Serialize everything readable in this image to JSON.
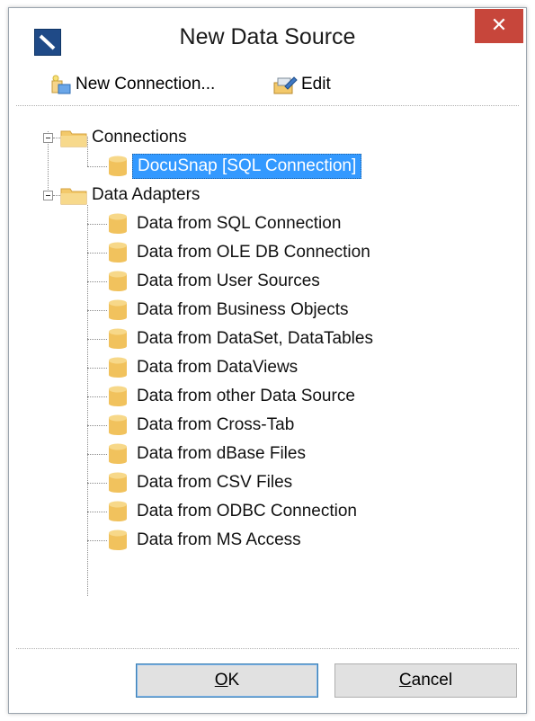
{
  "window": {
    "title": "New Data Source",
    "close_symbol": "✕"
  },
  "toolbar": {
    "new_connection_label": "New Connection...",
    "edit_label": "Edit",
    "new_connection_icon": "new-connection-icon",
    "edit_icon": "edit-icon"
  },
  "tree": {
    "connections": {
      "label": "Connections",
      "items": [
        {
          "label": "DocuSnap [SQL Connection]",
          "selected": true
        }
      ]
    },
    "data_adapters": {
      "label": "Data Adapters",
      "items": [
        {
          "label": "Data from SQL Connection"
        },
        {
          "label": "Data from OLE DB Connection"
        },
        {
          "label": "Data from User Sources"
        },
        {
          "label": "Data from Business Objects"
        },
        {
          "label": "Data from DataSet, DataTables"
        },
        {
          "label": "Data from DataViews"
        },
        {
          "label": "Data from other Data Source"
        },
        {
          "label": "Data from Cross-Tab"
        },
        {
          "label": "Data from dBase Files"
        },
        {
          "label": "Data from CSV Files"
        },
        {
          "label": "Data from ODBC Connection"
        },
        {
          "label": "Data from MS Access"
        }
      ]
    }
  },
  "buttons": {
    "ok_accel": "O",
    "ok_rest": "K",
    "cancel_accel": "C",
    "cancel_rest": "ancel"
  },
  "colors": {
    "selection": "#3399ff",
    "close_button": "#c7463b",
    "folder": "#f3c96b",
    "database": "#f1c25d"
  }
}
